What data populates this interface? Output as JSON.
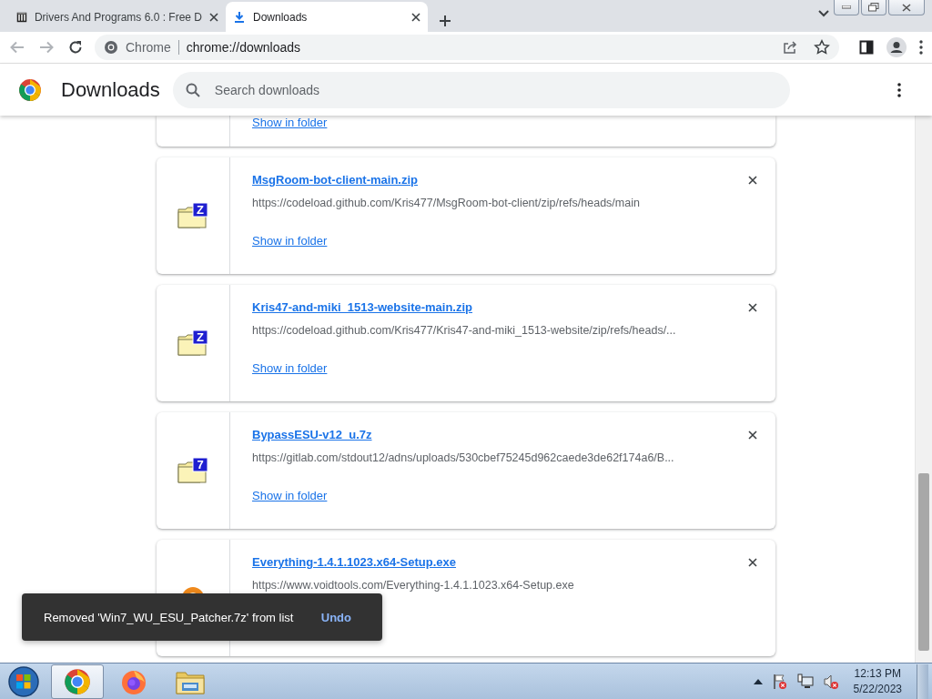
{
  "tabs": [
    {
      "title": "Drivers And Programs 6.0 : Free D",
      "kind": "archive-site",
      "selected": false
    },
    {
      "title": "Downloads",
      "kind": "downloads",
      "selected": true
    }
  ],
  "address_bar": {
    "site_label": "Chrome",
    "url": "chrome://downloads"
  },
  "header": {
    "title": "Downloads",
    "search_placeholder": "Search downloads"
  },
  "downloads": [
    {
      "kind": "partial",
      "link": "Show in folder"
    },
    {
      "kind": "archive",
      "badge": "Z",
      "name": "MsgRoom-bot-client-main.zip",
      "url": "https://codeload.github.com/Kris477/MsgRoom-bot-client/zip/refs/heads/main",
      "link": "Show in folder"
    },
    {
      "kind": "archive",
      "badge": "Z",
      "name": "Kris47-and-miki_1513-website-main.zip",
      "url": "https://codeload.github.com/Kris477/Kris47-and-miki_1513-website/zip/refs/heads/...",
      "link": "Show in folder"
    },
    {
      "kind": "archive",
      "badge": "7",
      "name": "BypassESU-v12_u.7z",
      "url": "https://gitlab.com/stdout12/adns/uploads/530cbef75245d962caede3de62f174a6/B...",
      "link": "Show in folder"
    },
    {
      "kind": "installer",
      "name": "Everything-1.4.1.1023.x64-Setup.exe",
      "url": "https://www.voidtools.com/Everything-1.4.1.1023.x64-Setup.exe"
    }
  ],
  "toast": {
    "message": "Removed 'Win7_WU_ESU_Patcher.7z' from list",
    "action": "Undo"
  },
  "taskbar": {
    "apps": [
      {
        "kind": "chrome",
        "selected": true
      },
      {
        "kind": "firefox",
        "selected": false
      },
      {
        "kind": "explorer",
        "selected": false
      }
    ],
    "time": "12:13 PM",
    "date": "5/22/2023"
  }
}
